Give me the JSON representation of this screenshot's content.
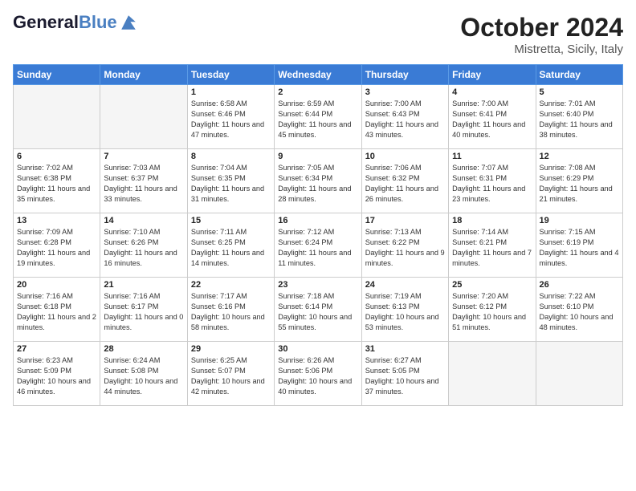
{
  "header": {
    "logo_line1": "General",
    "logo_line2": "Blue",
    "month": "October 2024",
    "location": "Mistretta, Sicily, Italy"
  },
  "weekdays": [
    "Sunday",
    "Monday",
    "Tuesday",
    "Wednesday",
    "Thursday",
    "Friday",
    "Saturday"
  ],
  "weeks": [
    [
      {
        "day": "",
        "info": ""
      },
      {
        "day": "",
        "info": ""
      },
      {
        "day": "1",
        "info": "Sunrise: 6:58 AM\nSunset: 6:46 PM\nDaylight: 11 hours and 47 minutes."
      },
      {
        "day": "2",
        "info": "Sunrise: 6:59 AM\nSunset: 6:44 PM\nDaylight: 11 hours and 45 minutes."
      },
      {
        "day": "3",
        "info": "Sunrise: 7:00 AM\nSunset: 6:43 PM\nDaylight: 11 hours and 43 minutes."
      },
      {
        "day": "4",
        "info": "Sunrise: 7:00 AM\nSunset: 6:41 PM\nDaylight: 11 hours and 40 minutes."
      },
      {
        "day": "5",
        "info": "Sunrise: 7:01 AM\nSunset: 6:40 PM\nDaylight: 11 hours and 38 minutes."
      }
    ],
    [
      {
        "day": "6",
        "info": "Sunrise: 7:02 AM\nSunset: 6:38 PM\nDaylight: 11 hours and 35 minutes."
      },
      {
        "day": "7",
        "info": "Sunrise: 7:03 AM\nSunset: 6:37 PM\nDaylight: 11 hours and 33 minutes."
      },
      {
        "day": "8",
        "info": "Sunrise: 7:04 AM\nSunset: 6:35 PM\nDaylight: 11 hours and 31 minutes."
      },
      {
        "day": "9",
        "info": "Sunrise: 7:05 AM\nSunset: 6:34 PM\nDaylight: 11 hours and 28 minutes."
      },
      {
        "day": "10",
        "info": "Sunrise: 7:06 AM\nSunset: 6:32 PM\nDaylight: 11 hours and 26 minutes."
      },
      {
        "day": "11",
        "info": "Sunrise: 7:07 AM\nSunset: 6:31 PM\nDaylight: 11 hours and 23 minutes."
      },
      {
        "day": "12",
        "info": "Sunrise: 7:08 AM\nSunset: 6:29 PM\nDaylight: 11 hours and 21 minutes."
      }
    ],
    [
      {
        "day": "13",
        "info": "Sunrise: 7:09 AM\nSunset: 6:28 PM\nDaylight: 11 hours and 19 minutes."
      },
      {
        "day": "14",
        "info": "Sunrise: 7:10 AM\nSunset: 6:26 PM\nDaylight: 11 hours and 16 minutes."
      },
      {
        "day": "15",
        "info": "Sunrise: 7:11 AM\nSunset: 6:25 PM\nDaylight: 11 hours and 14 minutes."
      },
      {
        "day": "16",
        "info": "Sunrise: 7:12 AM\nSunset: 6:24 PM\nDaylight: 11 hours and 11 minutes."
      },
      {
        "day": "17",
        "info": "Sunrise: 7:13 AM\nSunset: 6:22 PM\nDaylight: 11 hours and 9 minutes."
      },
      {
        "day": "18",
        "info": "Sunrise: 7:14 AM\nSunset: 6:21 PM\nDaylight: 11 hours and 7 minutes."
      },
      {
        "day": "19",
        "info": "Sunrise: 7:15 AM\nSunset: 6:19 PM\nDaylight: 11 hours and 4 minutes."
      }
    ],
    [
      {
        "day": "20",
        "info": "Sunrise: 7:16 AM\nSunset: 6:18 PM\nDaylight: 11 hours and 2 minutes."
      },
      {
        "day": "21",
        "info": "Sunrise: 7:16 AM\nSunset: 6:17 PM\nDaylight: 11 hours and 0 minutes."
      },
      {
        "day": "22",
        "info": "Sunrise: 7:17 AM\nSunset: 6:16 PM\nDaylight: 10 hours and 58 minutes."
      },
      {
        "day": "23",
        "info": "Sunrise: 7:18 AM\nSunset: 6:14 PM\nDaylight: 10 hours and 55 minutes."
      },
      {
        "day": "24",
        "info": "Sunrise: 7:19 AM\nSunset: 6:13 PM\nDaylight: 10 hours and 53 minutes."
      },
      {
        "day": "25",
        "info": "Sunrise: 7:20 AM\nSunset: 6:12 PM\nDaylight: 10 hours and 51 minutes."
      },
      {
        "day": "26",
        "info": "Sunrise: 7:22 AM\nSunset: 6:10 PM\nDaylight: 10 hours and 48 minutes."
      }
    ],
    [
      {
        "day": "27",
        "info": "Sunrise: 6:23 AM\nSunset: 5:09 PM\nDaylight: 10 hours and 46 minutes."
      },
      {
        "day": "28",
        "info": "Sunrise: 6:24 AM\nSunset: 5:08 PM\nDaylight: 10 hours and 44 minutes."
      },
      {
        "day": "29",
        "info": "Sunrise: 6:25 AM\nSunset: 5:07 PM\nDaylight: 10 hours and 42 minutes."
      },
      {
        "day": "30",
        "info": "Sunrise: 6:26 AM\nSunset: 5:06 PM\nDaylight: 10 hours and 40 minutes."
      },
      {
        "day": "31",
        "info": "Sunrise: 6:27 AM\nSunset: 5:05 PM\nDaylight: 10 hours and 37 minutes."
      },
      {
        "day": "",
        "info": ""
      },
      {
        "day": "",
        "info": ""
      }
    ]
  ]
}
